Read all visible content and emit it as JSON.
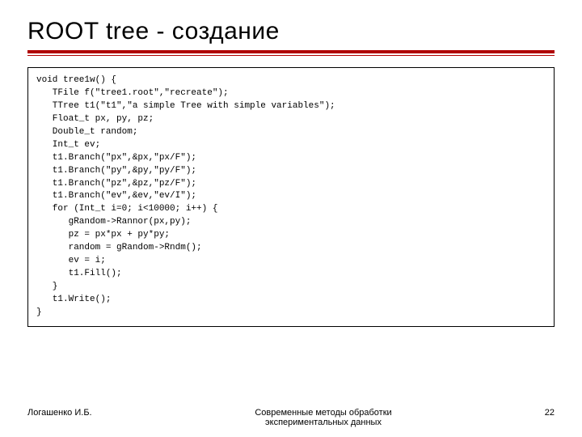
{
  "title": "ROOT tree - создание",
  "code": "void tree1w() {\n   TFile f(\"tree1.root\",\"recreate\");\n   TTree t1(\"t1\",\"a simple Tree with simple variables\");\n   Float_t px, py, pz;\n   Double_t random;\n   Int_t ev;\n   t1.Branch(\"px\",&px,\"px/F\");\n   t1.Branch(\"py\",&py,\"py/F\");\n   t1.Branch(\"pz\",&pz,\"pz/F\");\n   t1.Branch(\"ev\",&ev,\"ev/I\");\n   for (Int_t i=0; i<10000; i++) {\n      gRandom->Rannor(px,py);\n      pz = px*px + py*py;\n      random = gRandom->Rndm();\n      ev = i;\n      t1.Fill();\n   }\n   t1.Write();\n}",
  "footer": {
    "author": "Логашенко И.Б.",
    "center": "Современные методы обработки\nэкспериментальных данных",
    "page": "22"
  }
}
